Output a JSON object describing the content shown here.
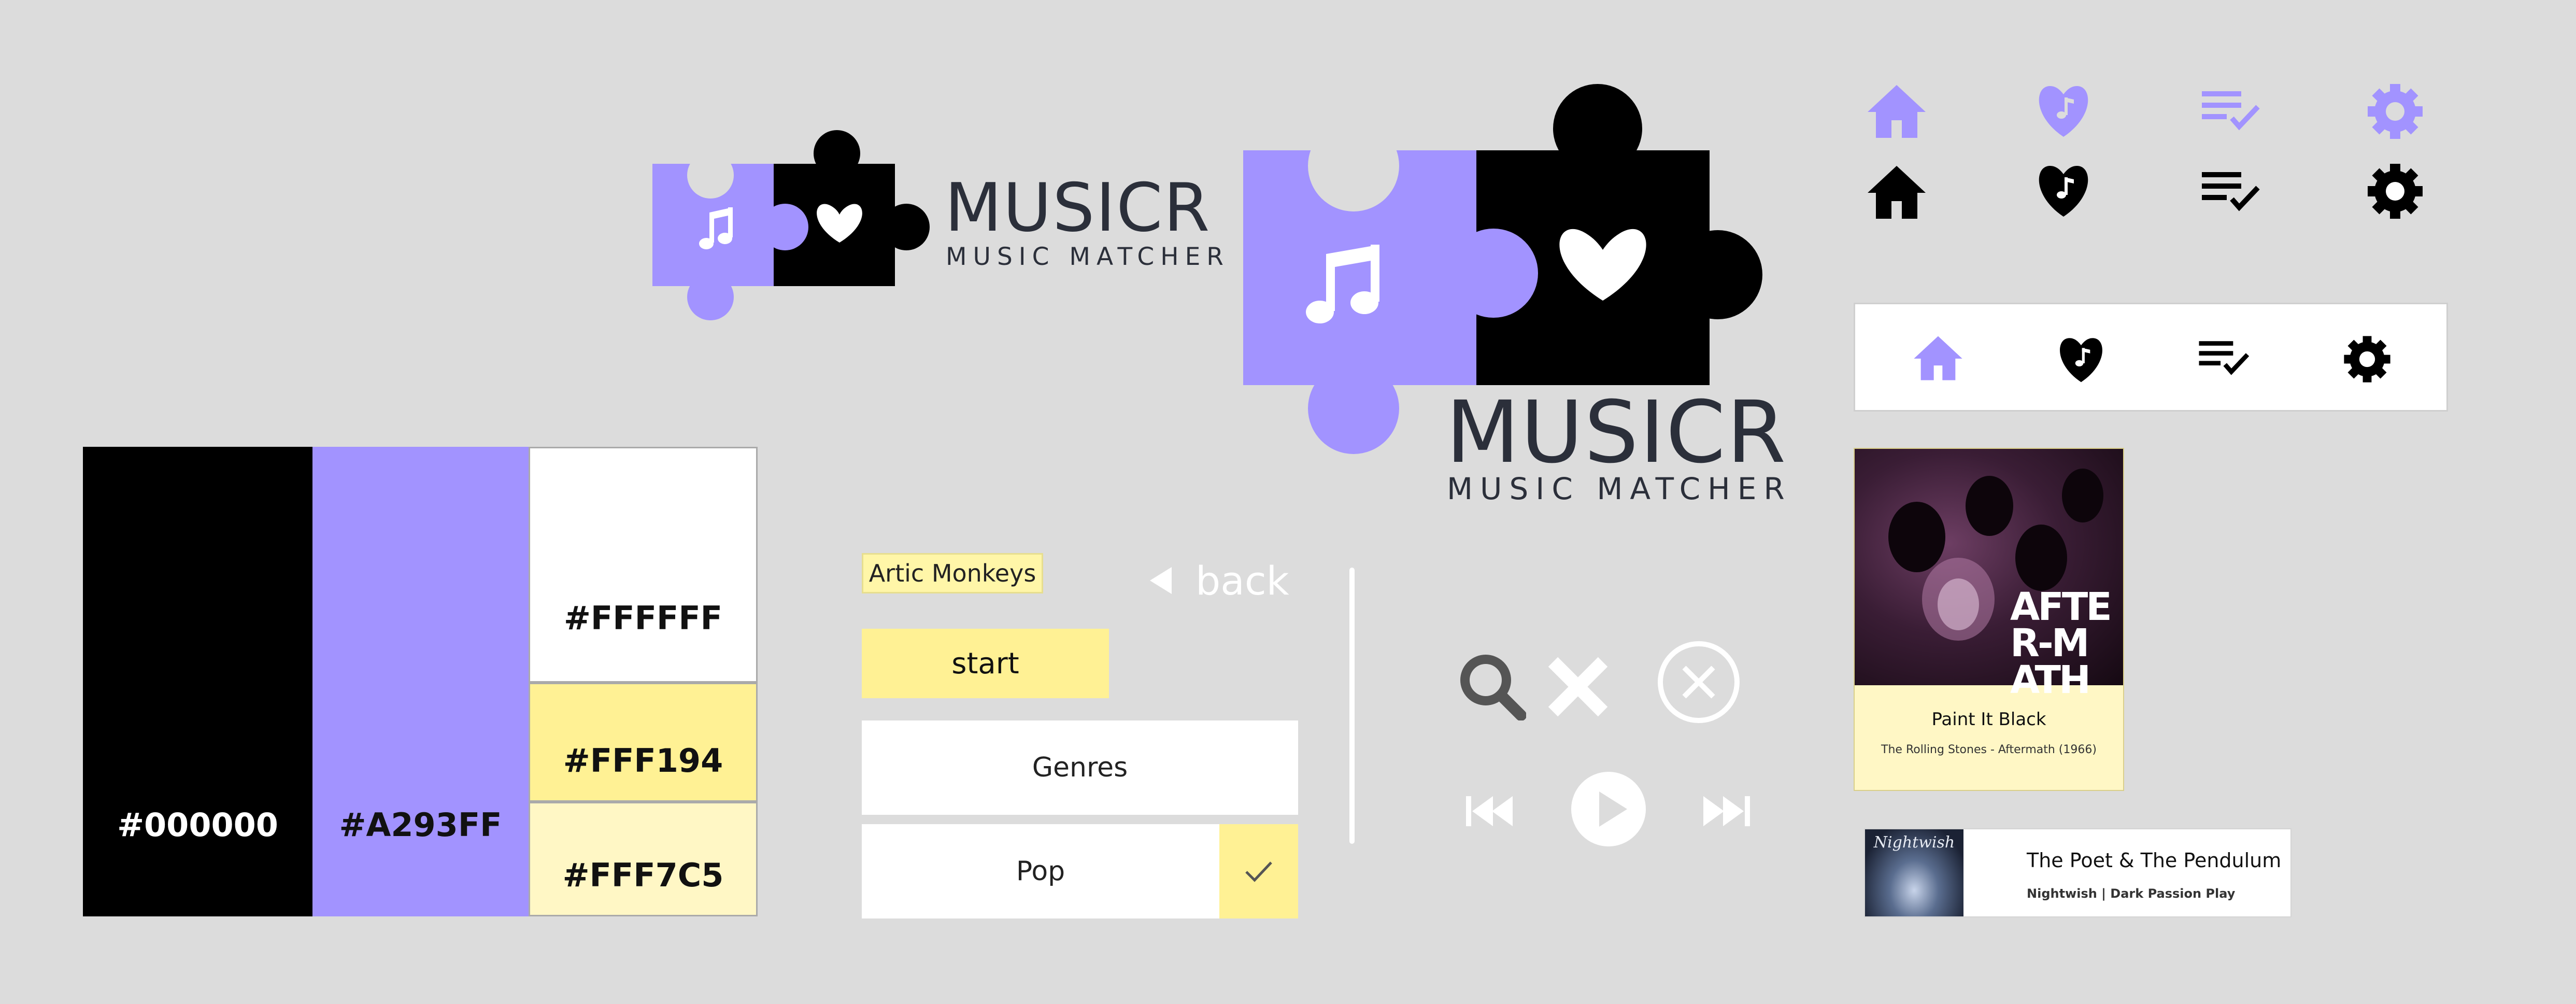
{
  "brand": {
    "title": "MUSICR",
    "subtitle": "MUSIC MATCHER",
    "colors": {
      "purple": "#A293FF",
      "black": "#000000",
      "white": "#FFFFFF"
    }
  },
  "palette": [
    {
      "hex": "#000000",
      "label": "#000000"
    },
    {
      "hex": "#A293FF",
      "label": "#A293FF"
    },
    {
      "hex": "#FFFFFF",
      "label": "#FFFFFF"
    },
    {
      "hex": "#FFF194",
      "label": "#FFF194"
    },
    {
      "hex": "#FFF7C5",
      "label": "#FFF7C5"
    }
  ],
  "controls": {
    "artist_chip": "Artic Monkeys",
    "back_label": "back",
    "start_label": "start",
    "genres_label": "Genres",
    "pop_label": "Pop"
  },
  "icons": {
    "top_row": [
      "home-icon",
      "heart-music-icon",
      "playlist-check-icon",
      "gear-icon"
    ],
    "player": [
      "search-icon",
      "close-icon",
      "close-circle-icon",
      "skip-back-icon",
      "play-icon",
      "skip-forward-icon"
    ]
  },
  "cards": {
    "featured": {
      "art_text": "AFTER-MATH",
      "title": "Paint It Black",
      "subtitle": "The Rolling Stones - Aftermath (1966)"
    },
    "list_item": {
      "art_text": "Nightwish",
      "title": "The Poet & The Pendulum",
      "subtitle": "Nightwish | Dark Passion Play"
    }
  }
}
